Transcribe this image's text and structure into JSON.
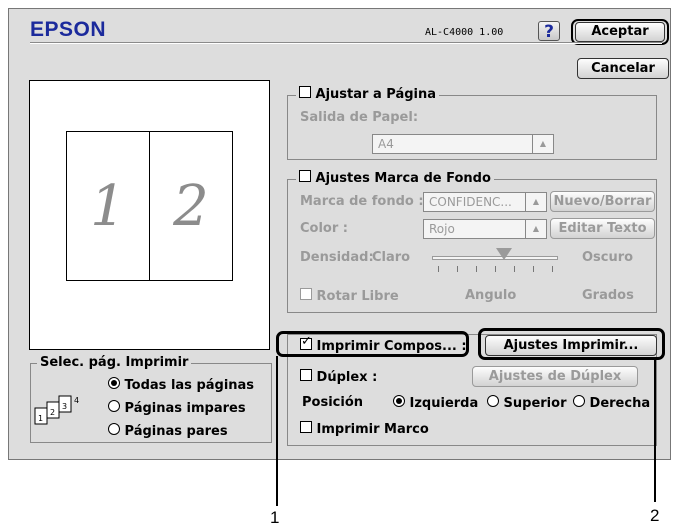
{
  "brand": "EPSON",
  "header": {
    "model": "AL-C4000  1.00",
    "help": "?",
    "accept_label": "Aceptar",
    "cancel_label": "Cancelar"
  },
  "preview": {
    "page1": "1",
    "page2": "2"
  },
  "fit_page": {
    "checkbox_label": "Ajustar a Página",
    "paper_output_label": "Salida de Papel:",
    "paper_value": "A4"
  },
  "watermark": {
    "checkbox_label": "Ajustes Marca de Fondo",
    "mark_label": "Marca de fondo :",
    "mark_value": "CONFIDENC...",
    "new_delete_button": "Nuevo/Borrar",
    "color_label": "Color :",
    "color_value": "Rojo",
    "edit_text_button": "Editar Texto",
    "density_label": "Densidad:",
    "density_low": "Claro",
    "density_high": "Oscuro",
    "density_value": 0.57,
    "rotate_label": "Rotar Libre",
    "angle_label": "Angulo",
    "degrees_label": "Grados"
  },
  "print_select": {
    "title": "Selec. pág. Imprimir",
    "options": [
      "Todas las páginas",
      "Páginas impares",
      "Páginas pares"
    ],
    "selected": 0
  },
  "layout": {
    "print_layout_label": "Imprimir Compos... :",
    "print_layout_checked": true,
    "print_settings_button": "Ajustes Imprimir...",
    "duplex_label": "Dúplex :",
    "duplex_settings_button": "Ajustes de Dúplex",
    "position_label": "Posición",
    "positions": [
      "Izquierda",
      "Superior",
      "Derecha"
    ],
    "position_selected": 0,
    "print_frame_label": "Imprimir Marco"
  },
  "callouts": [
    "1",
    "2"
  ]
}
